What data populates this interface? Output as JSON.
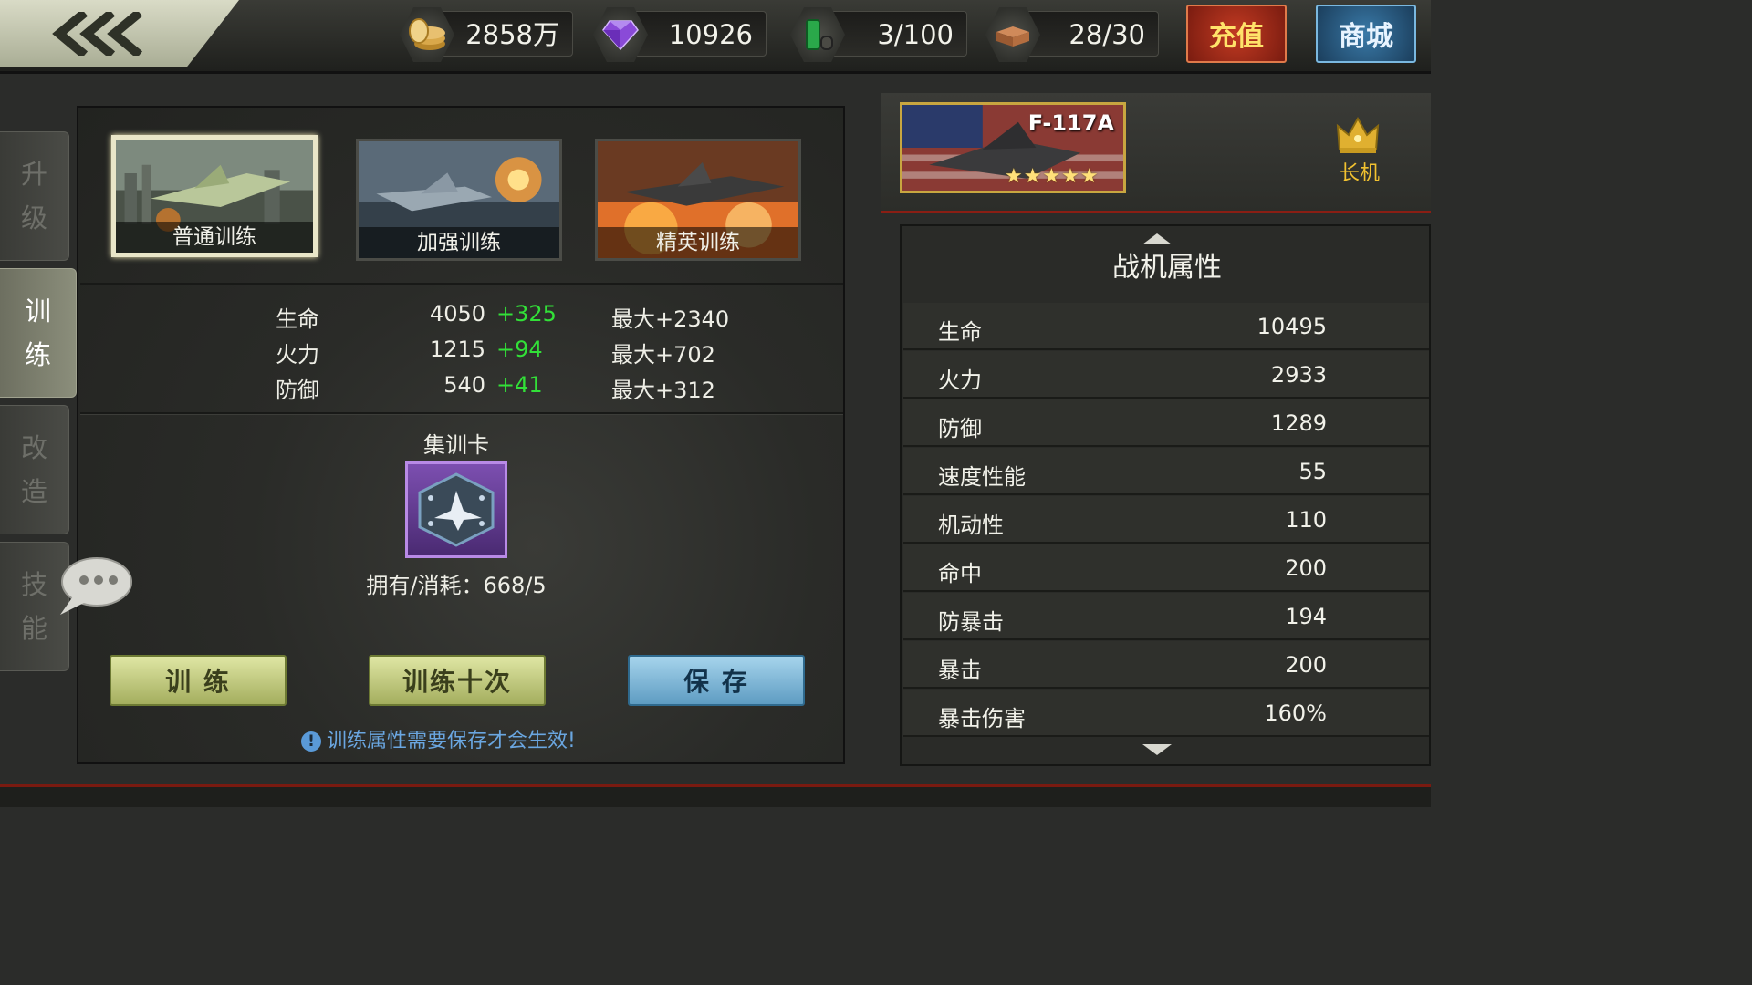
{
  "topbar": {
    "resources": [
      {
        "icon": "gold-coins-icon",
        "value": "2858万"
      },
      {
        "icon": "diamond-icon",
        "value": "10926"
      },
      {
        "icon": "fuel-icon",
        "value": "3/100"
      },
      {
        "icon": "material-bricks-icon",
        "value": "28/30"
      }
    ],
    "recharge_label": "充值",
    "shop_label": "商城"
  },
  "sidebar": {
    "tabs": [
      {
        "label_1": "升",
        "label_2": "级"
      },
      {
        "label_1": "训",
        "label_2": "练"
      },
      {
        "label_1": "改",
        "label_2": "造"
      },
      {
        "label_1": "技",
        "label_2": "能"
      }
    ],
    "active_tab": "训练"
  },
  "training": {
    "modes": [
      {
        "label": "普通训练"
      },
      {
        "label": "加强训练"
      },
      {
        "label": "精英训练"
      }
    ],
    "selected_mode": "普通训练",
    "stats": [
      {
        "name": "生命",
        "value": "4050",
        "increase": "+325",
        "max": "最大+2340"
      },
      {
        "name": "火力",
        "value": "1215",
        "increase": "+94",
        "max": "最大+702"
      },
      {
        "name": "防御",
        "value": "540",
        "increase": "+41",
        "max": "最大+312"
      }
    ],
    "card_title": "集训卡",
    "card_count": "拥有/消耗：668/5",
    "buttons": {
      "train": "训 练",
      "train_ten": "训练十次",
      "save": "保 存"
    },
    "hint": "训练属性需要保存才会生效!"
  },
  "plane": {
    "model": "F-117A",
    "stars": "★★★★★",
    "role_label": "长机"
  },
  "attributes": {
    "title": "战机属性",
    "rows": [
      {
        "name": "生命",
        "value": "10495"
      },
      {
        "name": "火力",
        "value": "2933"
      },
      {
        "name": "防御",
        "value": "1289"
      },
      {
        "name": "速度性能",
        "value": "55"
      },
      {
        "name": "机动性",
        "value": "110"
      },
      {
        "name": "命中",
        "value": "200"
      },
      {
        "name": "防暴击",
        "value": "194"
      },
      {
        "name": "暴击",
        "value": "200"
      },
      {
        "name": "暴击伤害",
        "value": "160%"
      }
    ]
  },
  "colors": {
    "increase_green": "#32e038",
    "hint_blue": "#6aa6e0",
    "leader_gold": "#f2c230"
  }
}
